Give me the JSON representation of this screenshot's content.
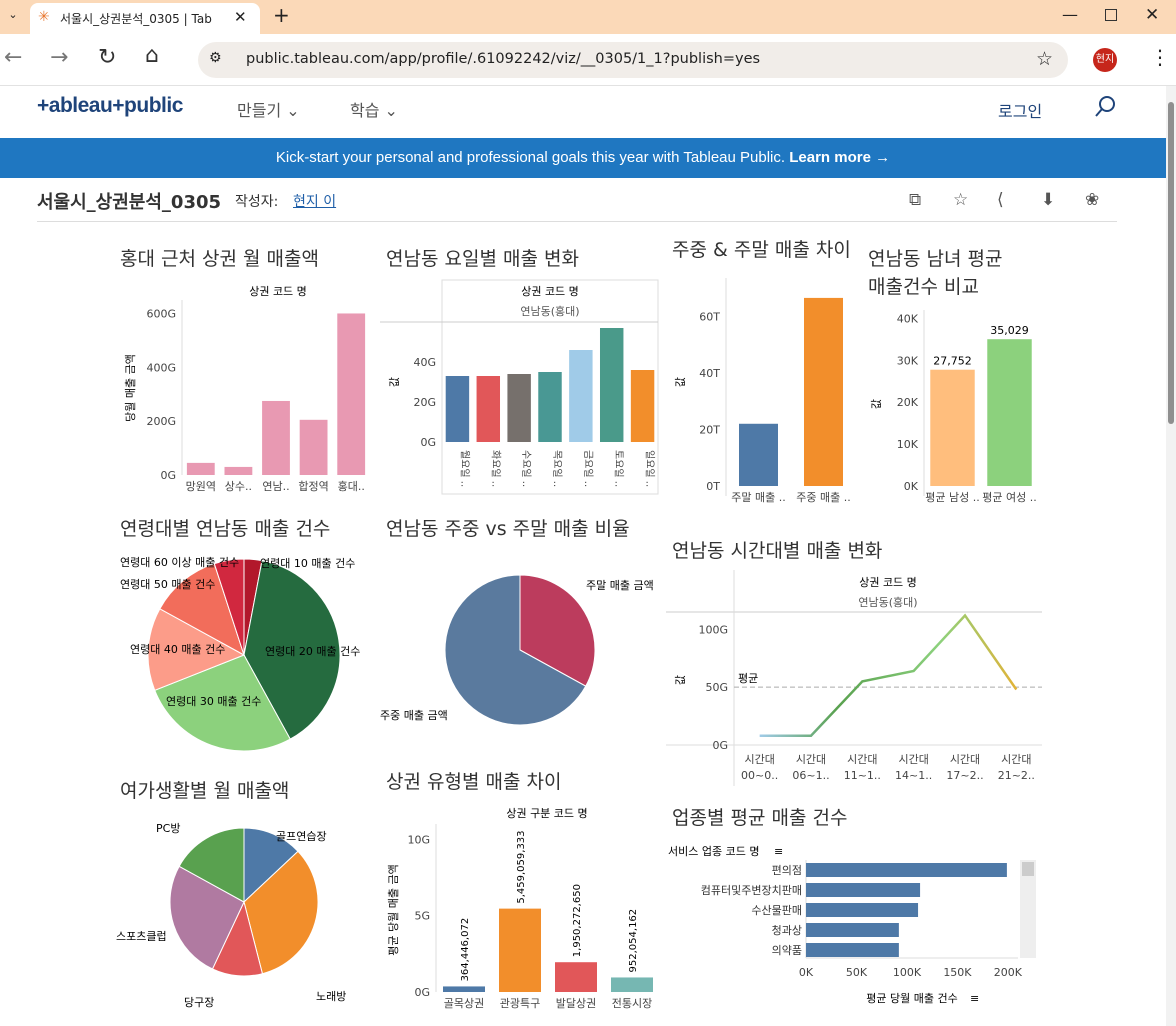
{
  "browser": {
    "tab_title": "서울시_상권분석_0305 | Tab",
    "url": "public.tableau.com/app/profile/.61092242/viz/__0305/1_1?publish=yes",
    "profile": "현지"
  },
  "nav": {
    "logo": "+ableau+public",
    "make": "만들기",
    "learn": "학습",
    "login": "로그인"
  },
  "banner": {
    "text": "Kick-start your personal and professional goals this year with Tableau Public.",
    "cta": "Learn more →"
  },
  "viz": {
    "title": "서울시_상권분석_0305",
    "author_label": "작성자:",
    "author": "현지 이"
  },
  "colors": {
    "banner": "#1f77c1",
    "pink": "#e899b2",
    "blue": "#4e79a7",
    "orange": "#f28e2b",
    "green": "#8cd17d",
    "dkgreen": "#256b3f"
  },
  "p1": {
    "title": "홍대 근처 상권 월 매출액",
    "header": "상권 코드 명",
    "ylabel": "당월 매출 금액",
    "chart_data": {
      "type": "bar",
      "categories": [
        "망원역",
        "상수..",
        "연남..",
        "합정역",
        "홍대.."
      ],
      "values": [
        45,
        30,
        275,
        205,
        600
      ],
      "ylim": [
        0,
        650
      ],
      "ticks": [
        "0G",
        "200G",
        "400G",
        "600G"
      ],
      "unit": "G"
    }
  },
  "p2": {
    "title": "연남동 요일별 매출 변화",
    "header": "상권 코드 명",
    "subheader": "연남동(홍대)",
    "ylabel": "값",
    "chart_data": {
      "type": "bar",
      "categories": [
        "월요일 ..",
        "화요일 ..",
        "수요일 ..",
        "목요일 ..",
        "금요일 ..",
        "토요일 ..",
        "일요일 .."
      ],
      "values": [
        33,
        33,
        34,
        35,
        46,
        57,
        36
      ],
      "colors": [
        "#4e79a7",
        "#e15759",
        "#76706c",
        "#499894",
        "#a0cbe8",
        "#4a9a8a",
        "#f28e2b"
      ],
      "ylim": [
        0,
        60
      ],
      "ticks": [
        "0G",
        "20G",
        "40G"
      ],
      "unit": "G"
    }
  },
  "p3": {
    "title": "주중 & 주말 매출 차이",
    "ylabel": "값",
    "chart_data": {
      "type": "bar",
      "categories": [
        "주말 매출 ..",
        "주중 매출 .."
      ],
      "values": [
        22,
        66.5
      ],
      "colors": [
        "#4e79a7",
        "#f28e2b"
      ],
      "ylim": [
        0,
        70
      ],
      "ticks": [
        "0T",
        "20T",
        "40T",
        "60T"
      ],
      "unit": "T"
    }
  },
  "p4": {
    "title": "연남동 남녀 평균 매출건수 비교",
    "ylabel": "값",
    "chart_data": {
      "type": "bar",
      "categories": [
        "평균 남성 ..",
        "평균 여성 .."
      ],
      "values": [
        27752,
        35029
      ],
      "labels": [
        "27,752",
        "35,029"
      ],
      "colors": [
        "#ffbe7d",
        "#8cd17d"
      ],
      "ylim": [
        0,
        42000
      ],
      "ticks": [
        "0K",
        "10K",
        "20K",
        "30K",
        "40K"
      ],
      "unit": "K"
    }
  },
  "p5": {
    "title": "연령대별 연남동 매출 건수",
    "chart_data": {
      "type": "pie",
      "labels": [
        "연령대 10 매출 건수",
        "연령대 20 매출 건수",
        "연령대 30 매출 건수",
        "연령대 40 매출 건수",
        "연령대 50 매출 건수",
        "연령대 60 이상 매출 건수"
      ],
      "values": [
        3,
        39,
        27,
        14,
        12,
        5
      ],
      "colors": [
        "#b2182b",
        "#256b3f",
        "#8cd17d",
        "#fc9c89",
        "#f26d5b",
        "#d1283f"
      ]
    }
  },
  "p6": {
    "title": "연남동 주중 vs 주말 매출 비율",
    "chart_data": {
      "type": "pie",
      "labels": [
        "주말 매출 금액",
        "주중 매출 금액"
      ],
      "values": [
        33,
        67
      ],
      "colors": [
        "#bc3c5d",
        "#5a7a9e"
      ]
    }
  },
  "p7": {
    "title": "연남동 시간대별 매출 변화",
    "header": "상권 코드 명",
    "subheader": "연남동(홍대)",
    "ylabel": "값",
    "avg_label": "평균",
    "chart_data": {
      "type": "line",
      "categories": [
        "시간대 00~0..",
        "시간대 06~1..",
        "시간대 11~1..",
        "시간대 14~1..",
        "시간대 17~2..",
        "시간대 21~2.."
      ],
      "cat_line1": [
        "시간대",
        "시간대",
        "시간대",
        "시간대",
        "시간대",
        "시간대"
      ],
      "cat_line2": [
        "00~0..",
        "06~1..",
        "11~1..",
        "14~1..",
        "17~2..",
        "21~2.."
      ],
      "values": [
        8,
        8,
        55,
        64,
        112,
        48
      ],
      "average": 50,
      "ylim": [
        0,
        115
      ],
      "ticks": [
        "0G",
        "50G",
        "100G"
      ],
      "unit": "G"
    }
  },
  "p8": {
    "title": "여가생활별 월 매출액",
    "chart_data": {
      "type": "pie",
      "labels": [
        "골프연습장",
        "노래방",
        "당구장",
        "스포츠클럽",
        "PC방"
      ],
      "values": [
        13,
        33,
        11,
        26,
        17
      ],
      "colors": [
        "#4e79a7",
        "#f28e2b",
        "#e15759",
        "#b07aa1",
        "#59a14f"
      ]
    }
  },
  "p9": {
    "title": "상권 유형별 매출 차이",
    "header": "상권 구분 코드 명",
    "ylabel": "평균 당월 매출 금액",
    "chart_data": {
      "type": "bar",
      "categories": [
        "골목상권",
        "관광특구",
        "발달상권",
        "전통시장"
      ],
      "values": [
        364446072,
        5459059333,
        1950272650,
        952054162
      ],
      "labels": [
        "364,446,072",
        "5,459,059,333",
        "1,950,272,650",
        "952,054,162"
      ],
      "colors": [
        "#4e79a7",
        "#f28e2b",
        "#e15759",
        "#76b7b2"
      ],
      "ylim": [
        0,
        11000000000
      ],
      "ticks": [
        "0G",
        "5G",
        "10G"
      ],
      "unit": "G"
    }
  },
  "p10": {
    "title": "업종별 평균 매출 건수",
    "row_header": "서비스 업종 코드 명",
    "xlabel": "평균 당월 매출 건수",
    "chart_data": {
      "type": "hbar",
      "categories": [
        "편의점",
        "컴퓨터및주변장치판매",
        "수산물판매",
        "청과상",
        "의약품"
      ],
      "values": [
        199000,
        113000,
        111000,
        92000,
        92000
      ],
      "xlim": [
        0,
        210000
      ],
      "ticks": [
        "0K",
        "50K",
        "100K",
        "150K",
        "200K"
      ],
      "color": "#4e79a7"
    }
  }
}
